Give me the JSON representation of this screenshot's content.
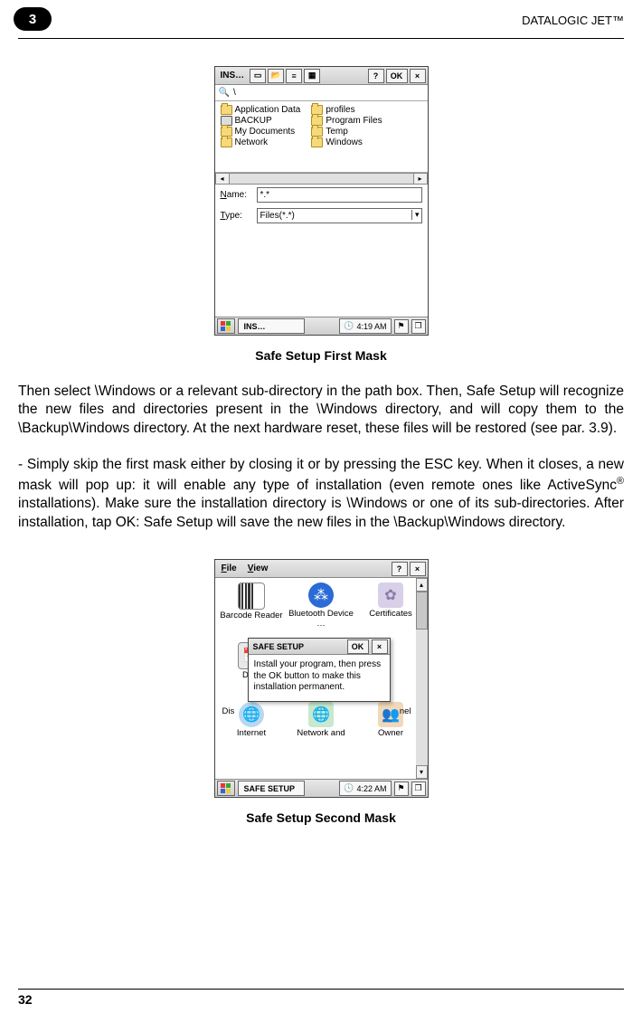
{
  "header": {
    "section_number": "3",
    "product": "DATALOGIC JET™"
  },
  "figure1": {
    "titlebar": {
      "title": "INS…",
      "help": "?",
      "ok": "OK",
      "close": "×"
    },
    "path": "\\",
    "folders_left": [
      {
        "name": "Application Data",
        "icon": "folder"
      },
      {
        "name": "BACKUP",
        "icon": "disk"
      },
      {
        "name": "My Documents",
        "icon": "folder"
      },
      {
        "name": "Network",
        "icon": "folder"
      }
    ],
    "folders_right": [
      {
        "name": "profiles",
        "icon": "folder"
      },
      {
        "name": "Program Files",
        "icon": "folder"
      },
      {
        "name": "Temp",
        "icon": "folder"
      },
      {
        "name": "Windows",
        "icon": "folder"
      }
    ],
    "name_label": "Name:",
    "name_value": "*.*",
    "type_label": "Type:",
    "type_value": "Files(*.*)",
    "taskbar": {
      "app": "INS…",
      "time": "4:19 AM"
    },
    "caption": "Safe Setup First Mask"
  },
  "para1": "Then select \\Windows or a relevant sub-directory in the path box. Then, Safe Setup will recognize the new files and directories present in the \\Windows directory, and will copy them to the \\Backup\\Windows directory. At the next hardware reset, these files will be restored (see par. 3.9).",
  "para2_pre": "- Simply skip the first mask either by closing it or by pressing the ESC key. When it closes, a new mask will pop up: it will enable any type of installation (even remote ones like ActiveSync",
  "para2_sup": "®",
  "para2_post": " installations). Make sure the installation directory is \\Windows or one of its sub-directories. After installation, tap OK: Safe Setup will save the new files in the \\Backup\\Windows directory.",
  "figure2": {
    "menu": {
      "file": "File",
      "view": "View",
      "help": "?",
      "close": "×"
    },
    "items_row1": [
      {
        "label": "Barcode Reader"
      },
      {
        "label": "Bluetooth Device …"
      },
      {
        "label": "Certificates"
      }
    ],
    "items_row2": [
      {
        "label": "Date"
      },
      {
        "label": ""
      },
      {
        "label": ""
      }
    ],
    "items_row2b": [
      {
        "label": "Dis"
      },
      {
        "label": ""
      },
      {
        "label": "nel"
      }
    ],
    "items_row3": [
      {
        "label": "Internet"
      },
      {
        "label": "Network and"
      },
      {
        "label": "Owner"
      }
    ],
    "popup": {
      "title": "SAFE SETUP",
      "ok": "OK",
      "close": "×",
      "body": "Install your program, then press the OK button to make this installation permanent."
    },
    "taskbar": {
      "app": "SAFE SETUP",
      "time": "4:22 AM"
    },
    "caption": "Safe Setup Second Mask"
  },
  "footer": {
    "page": "32"
  }
}
